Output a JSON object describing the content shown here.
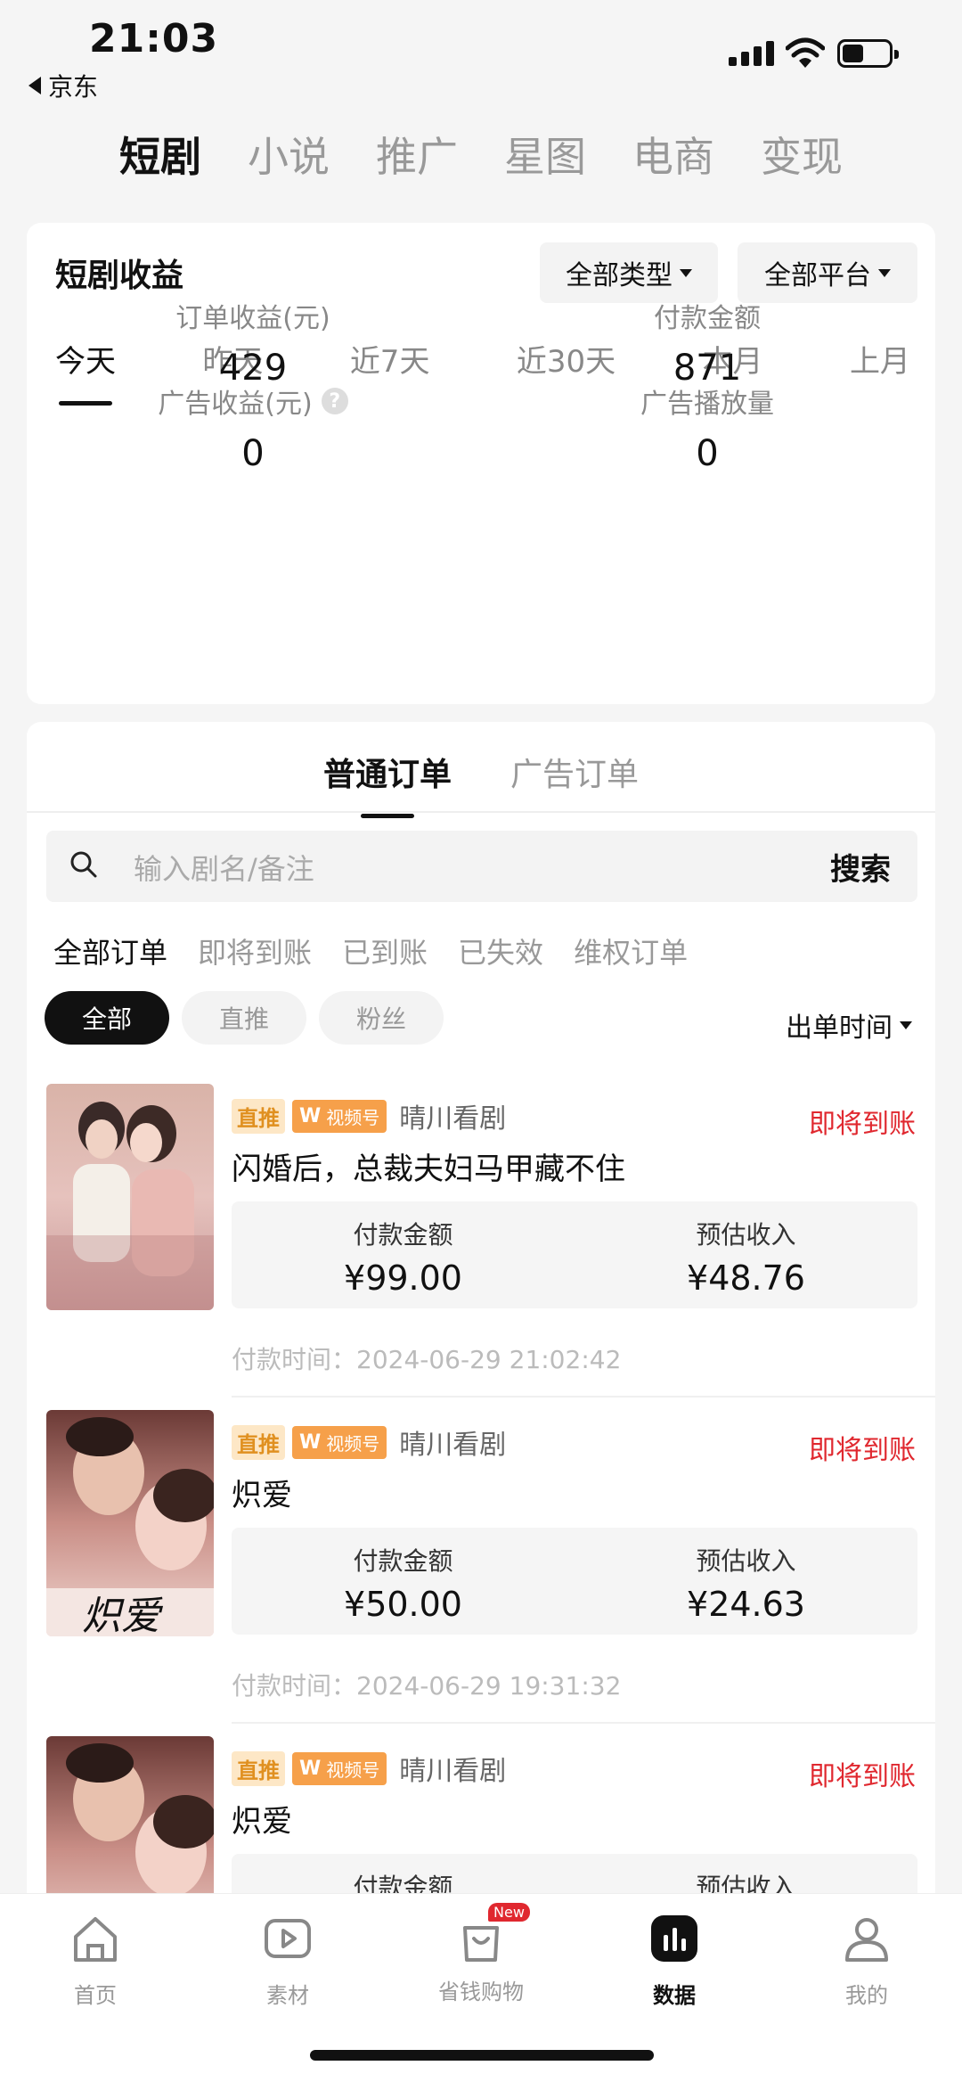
{
  "status_bar": {
    "time": "21:03",
    "back_label": "京东"
  },
  "top_tabs": [
    {
      "label": "短剧",
      "active": true
    },
    {
      "label": "小说",
      "active": false
    },
    {
      "label": "推广",
      "active": false
    },
    {
      "label": "星图",
      "active": false
    },
    {
      "label": "电商",
      "active": false
    },
    {
      "label": "变现",
      "active": false
    }
  ],
  "earnings": {
    "title": "短剧收益",
    "type_filter": "全部类型",
    "platform_filter": "全部平台",
    "periods": [
      "今天",
      "昨天",
      "近7天",
      "近30天",
      "本月",
      "上月"
    ],
    "active_period": "今天",
    "metrics": {
      "order_income": {
        "label": "订单收益(元)",
        "value": "429"
      },
      "paid_amount": {
        "label": "付款金额",
        "value": "871"
      },
      "ad_income": {
        "label": "广告收益(元)",
        "value": "0"
      },
      "ad_plays": {
        "label": "广告播放量",
        "value": "0"
      }
    }
  },
  "orders": {
    "tabs": [
      "普通订单",
      "广告订单"
    ],
    "search_placeholder": "输入剧名/备注",
    "search_button": "搜索",
    "filters": [
      "全部订单",
      "即将到账",
      "已到账",
      "已失效",
      "维权订单"
    ],
    "chips": [
      "全部",
      "直推",
      "粉丝"
    ],
    "sort_label": "出单时间",
    "items": [
      {
        "tag_direct": "直推",
        "tag_video": "视频号",
        "channel": "晴川看剧",
        "status": "即将到账",
        "title": "闪婚后，总裁夫妇马甲藏不住",
        "paid_label": "付款金额",
        "paid_value": "¥99.00",
        "income_label": "预估收入",
        "income_value": "¥48.76",
        "time": "付款时间：2024-06-29 21:02:42"
      },
      {
        "tag_direct": "直推",
        "tag_video": "视频号",
        "channel": "晴川看剧",
        "status": "即将到账",
        "title": "炽爱",
        "paid_label": "付款金额",
        "paid_value": "¥50.00",
        "income_label": "预估收入",
        "income_value": "¥24.63",
        "time": "付款时间：2024-06-29 19:31:32"
      },
      {
        "tag_direct": "直推",
        "tag_video": "视频号",
        "channel": "晴川看剧",
        "status": "即将到账",
        "title": "炽爱",
        "paid_label": "付款金额",
        "paid_value": "",
        "income_label": "预估收入",
        "income_value": "",
        "time": ""
      }
    ]
  },
  "bottom_nav": [
    {
      "label": "首页",
      "icon": "home-icon"
    },
    {
      "label": "素材",
      "icon": "play-icon"
    },
    {
      "label": "省钱购物",
      "icon": "shopping-bag-icon",
      "badge": "New"
    },
    {
      "label": "数据",
      "icon": "bar-chart-icon",
      "active": true
    },
    {
      "label": "我的",
      "icon": "user-icon"
    }
  ],
  "colors": {
    "accent_red": "#e0282f",
    "tag_orange": "#f6a04a",
    "tag_direct_bg": "#fde7c6"
  }
}
